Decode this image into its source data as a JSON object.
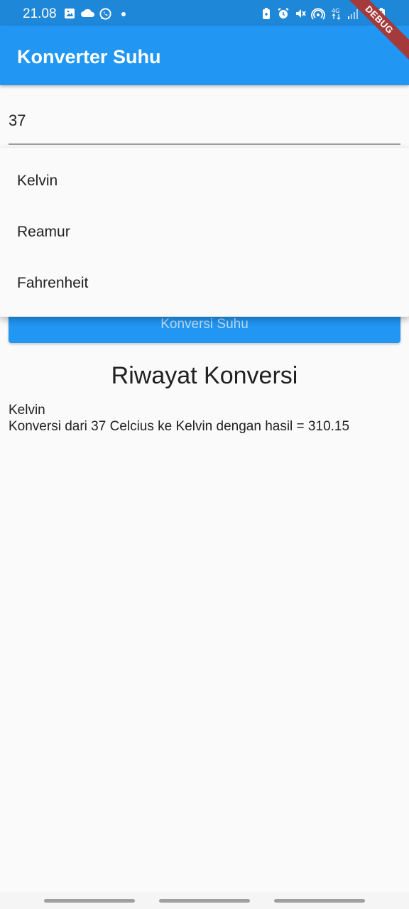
{
  "status_bar": {
    "time": "21.08",
    "left_icons": [
      "image-icon",
      "cloud-icon",
      "whatsapp-icon",
      "dot-icon"
    ],
    "right_icons": [
      "battery-saver-icon",
      "alarm-icon",
      "mute-icon",
      "hotspot-icon",
      "4g-icon",
      "signal-icon",
      "battery-icon"
    ]
  },
  "app_bar": {
    "title": "Konverter Suhu",
    "color": "#2196f3"
  },
  "debug_banner": "DEBUG",
  "input": {
    "value": "37"
  },
  "dropdown": {
    "options": [
      "Kelvin",
      "Reamur",
      "Fahrenheit"
    ]
  },
  "convert_button": {
    "label": "Konversi Suhu"
  },
  "history": {
    "title": "Riwayat Konversi",
    "items": [
      {
        "unit": "Kelvin",
        "text": "Konversi dari 37 Celcius ke Kelvin dengan hasil = 310.15"
      }
    ]
  }
}
